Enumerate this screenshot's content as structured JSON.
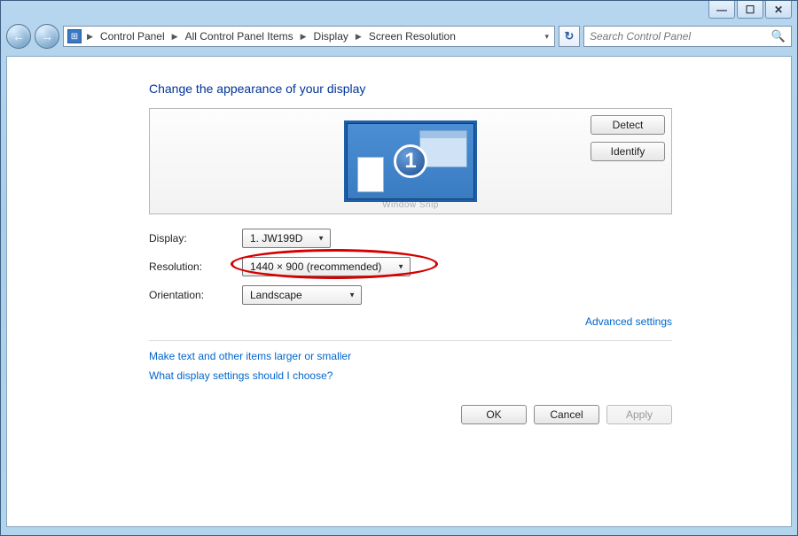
{
  "window": {
    "min_glyph": "—",
    "max_glyph": "☐",
    "close_glyph": "✕"
  },
  "nav": {
    "back_glyph": "←",
    "fwd_glyph": "→",
    "refresh_glyph": "↻",
    "breadcrumb_sep": "▶",
    "dropdown_glyph": "▾",
    "crumbs": [
      "Control Panel",
      "All Control Panel Items",
      "Display",
      "Screen Resolution"
    ]
  },
  "search": {
    "placeholder": "Search Control Panel",
    "icon_glyph": "🔍"
  },
  "main": {
    "heading": "Change the appearance of your display",
    "monitor_number": "1",
    "watermark": "Window Snip",
    "detect_label": "Detect",
    "identify_label": "Identify"
  },
  "form": {
    "display_label": "Display:",
    "display_value": "1. JW199D",
    "resolution_label": "Resolution:",
    "resolution_value": "1440 × 900 (recommended)",
    "orientation_label": "Orientation:",
    "orientation_value": "Landscape"
  },
  "links": {
    "advanced": "Advanced settings",
    "text_size": "Make text and other items larger or smaller",
    "help": "What display settings should I choose?"
  },
  "buttons": {
    "ok": "OK",
    "cancel": "Cancel",
    "apply": "Apply"
  }
}
